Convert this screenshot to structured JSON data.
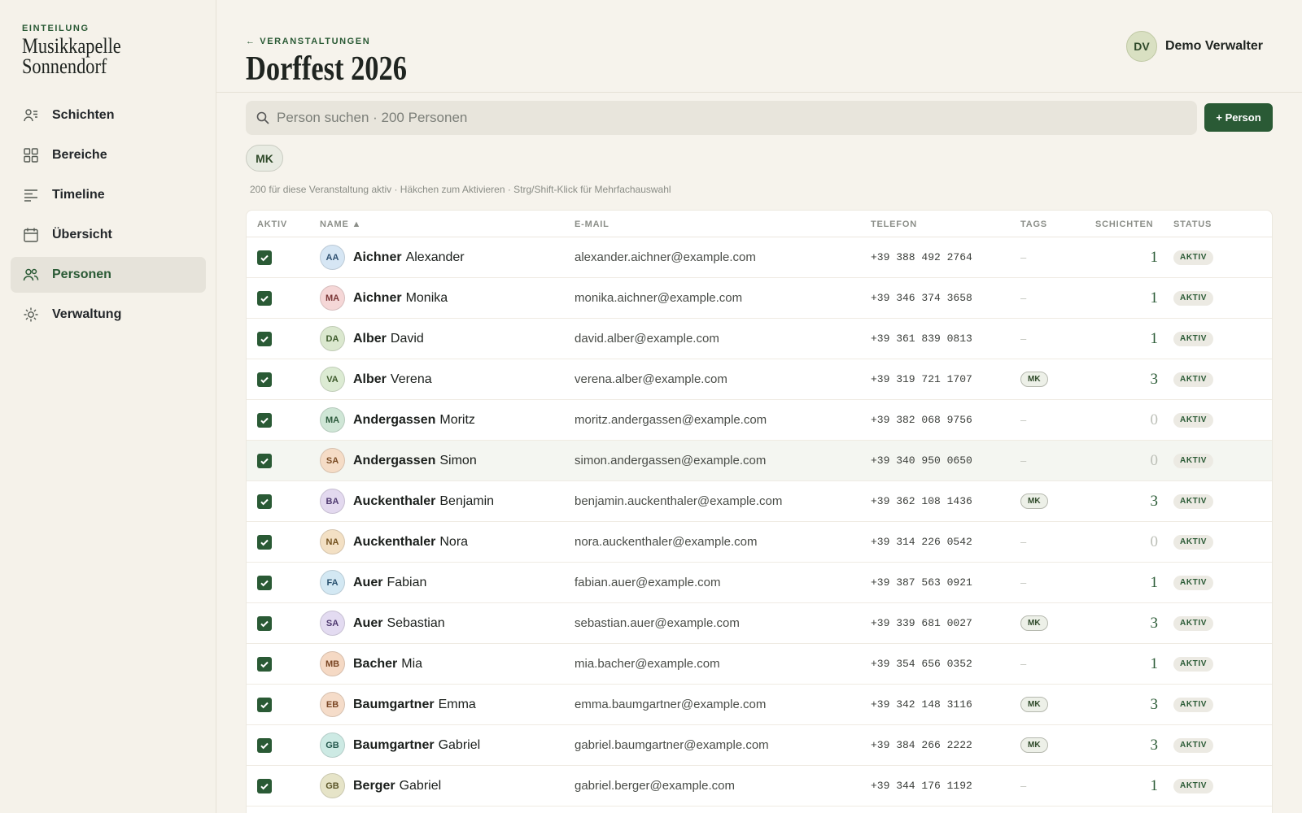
{
  "brand": {
    "kicker": "EINTEILUNG",
    "name_line1": "Musikkapelle",
    "name_line2": "Sonnendorf"
  },
  "nav": [
    {
      "label": "Schichten",
      "icon": "user-list-icon",
      "active": false
    },
    {
      "label": "Bereiche",
      "icon": "grid-icon",
      "active": false
    },
    {
      "label": "Timeline",
      "icon": "lines-icon",
      "active": false
    },
    {
      "label": "Übersicht",
      "icon": "calendar-icon",
      "active": false
    },
    {
      "label": "Personen",
      "icon": "people-icon",
      "active": true
    },
    {
      "label": "Verwaltung",
      "icon": "gear-icon",
      "active": false
    }
  ],
  "header": {
    "breadcrumb": "← VERANSTALTUNGEN",
    "title": "Dorffest 2026",
    "user_initials": "DV",
    "user_name": "Demo Verwalter"
  },
  "search": {
    "placeholder": "Person suchen · 200 Personen",
    "value": ""
  },
  "add_button": "+ Person",
  "filter_chip": "MK",
  "hint": "200 für diese Veranstaltung aktiv · Häkchen zum Aktivieren · Strg/Shift-Klick für Mehrfachauswahl",
  "table": {
    "columns": {
      "active": "AKTIV",
      "name": "NAME ▲",
      "email": "E-MAIL",
      "phone": "TELEFON",
      "tags": "TAGS",
      "shifts": "SCHICHTEN",
      "status": "STATUS"
    },
    "rows": [
      {
        "initials": "AA",
        "last": "Aichner",
        "first": "Alexander",
        "email": "alexander.aichner@example.com",
        "phone": "+39 388 492 2764",
        "tag": "–",
        "shifts": "1",
        "status": "AKTIV",
        "avatar_bg": "#d6e6f4",
        "avatar_fg": "#2d4f70"
      },
      {
        "initials": "MA",
        "last": "Aichner",
        "first": "Monika",
        "email": "monika.aichner@example.com",
        "phone": "+39 346 374 3658",
        "tag": "–",
        "shifts": "1",
        "status": "AKTIV",
        "avatar_bg": "#f5d7d7",
        "avatar_fg": "#7a3636"
      },
      {
        "initials": "DA",
        "last": "Alber",
        "first": "David",
        "email": "david.alber@example.com",
        "phone": "+39 361 839 0813",
        "tag": "–",
        "shifts": "1",
        "status": "AKTIV",
        "avatar_bg": "#dbe8cf",
        "avatar_fg": "#3d5a2b"
      },
      {
        "initials": "VA",
        "last": "Alber",
        "first": "Verena",
        "email": "verena.alber@example.com",
        "phone": "+39 319 721 1707",
        "tag": "MK",
        "shifts": "3",
        "status": "AKTIV",
        "avatar_bg": "#dcebd3",
        "avatar_fg": "#3d5a2b"
      },
      {
        "initials": "MA",
        "last": "Andergassen",
        "first": "Moritz",
        "email": "moritz.andergassen@example.com",
        "phone": "+39 382 068 9756",
        "tag": "–",
        "shifts": "0",
        "status": "AKTIV",
        "avatar_bg": "#cfe6d6",
        "avatar_fg": "#2c5a3c"
      },
      {
        "initials": "SA",
        "last": "Andergassen",
        "first": "Simon",
        "email": "simon.andergassen@example.com",
        "phone": "+39 340 950 0650",
        "tag": "–",
        "shifts": "0",
        "status": "AKTIV",
        "avatar_bg": "#f5dcc6",
        "avatar_fg": "#7a4b24"
      },
      {
        "initials": "BA",
        "last": "Auckenthaler",
        "first": "Benjamin",
        "email": "benjamin.auckenthaler@example.com",
        "phone": "+39 362 108 1436",
        "tag": "MK",
        "shifts": "3",
        "status": "AKTIV",
        "avatar_bg": "#e3d9ef",
        "avatar_fg": "#4f3a70"
      },
      {
        "initials": "NA",
        "last": "Auckenthaler",
        "first": "Nora",
        "email": "nora.auckenthaler@example.com",
        "phone": "+39 314 226 0542",
        "tag": "–",
        "shifts": "0",
        "status": "AKTIV",
        "avatar_bg": "#f3e0c4",
        "avatar_fg": "#74521f"
      },
      {
        "initials": "FA",
        "last": "Auer",
        "first": "Fabian",
        "email": "fabian.auer@example.com",
        "phone": "+39 387 563 0921",
        "tag": "–",
        "shifts": "1",
        "status": "AKTIV",
        "avatar_bg": "#d3e8f3",
        "avatar_fg": "#2a5270"
      },
      {
        "initials": "SA",
        "last": "Auer",
        "first": "Sebastian",
        "email": "sebastian.auer@example.com",
        "phone": "+39 339 681 0027",
        "tag": "MK",
        "shifts": "3",
        "status": "AKTIV",
        "avatar_bg": "#e3dbf1",
        "avatar_fg": "#4f3a70"
      },
      {
        "initials": "MB",
        "last": "Bacher",
        "first": "Mia",
        "email": "mia.bacher@example.com",
        "phone": "+39 354 656 0352",
        "tag": "–",
        "shifts": "1",
        "status": "AKTIV",
        "avatar_bg": "#f5d9c4",
        "avatar_fg": "#7a4624"
      },
      {
        "initials": "EB",
        "last": "Baumgartner",
        "first": "Emma",
        "email": "emma.baumgartner@example.com",
        "phone": "+39 342 148 3116",
        "tag": "MK",
        "shifts": "3",
        "status": "AKTIV",
        "avatar_bg": "#f5dcc9",
        "avatar_fg": "#7a4624"
      },
      {
        "initials": "GB",
        "last": "Baumgartner",
        "first": "Gabriel",
        "email": "gabriel.baumgartner@example.com",
        "phone": "+39 384 266 2222",
        "tag": "MK",
        "shifts": "3",
        "status": "AKTIV",
        "avatar_bg": "#cdeae4",
        "avatar_fg": "#25594e"
      },
      {
        "initials": "GB",
        "last": "Berger",
        "first": "Gabriel",
        "email": "gabriel.berger@example.com",
        "phone": "+39 344 176 1192",
        "tag": "–",
        "shifts": "1",
        "status": "AKTIV",
        "avatar_bg": "#e6e4c8",
        "avatar_fg": "#5a5528"
      }
    ]
  },
  "colors": {
    "accent": "#2a5a35",
    "background": "#f6f3ec",
    "sidebar_active": "#e6e3da"
  }
}
